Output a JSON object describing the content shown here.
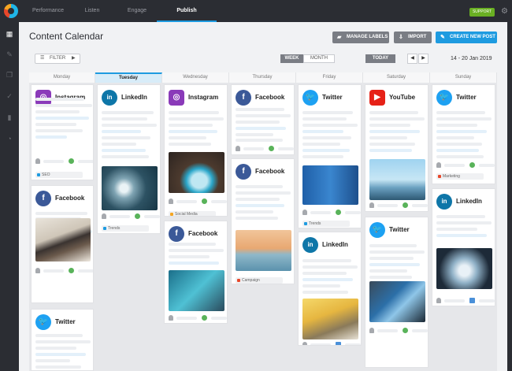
{
  "nav": {
    "tabs": [
      "Performance",
      "Listen",
      "Engage",
      "Publish"
    ],
    "support": "SUPPORT"
  },
  "header": {
    "title": "Content Calendar",
    "manage_labels": "MANAGE LABELS",
    "import": "IMPORT",
    "create_post": "CREATE NEW POST"
  },
  "controls": {
    "filter": "FILTER",
    "week": "WEEK",
    "month": "MONTH",
    "today": "TODAY",
    "prev": "◀",
    "next": "▶",
    "date_range": "14 - 20 Jan 2019"
  },
  "days": [
    "Monday",
    "Tuesday",
    "Wednesday",
    "Thursday",
    "Friday",
    "Saturday",
    "Sunday"
  ],
  "today_index": 1,
  "networks": {
    "Instagram": {
      "color": "#8a3ab9",
      "icon": "instagram-icon",
      "glyph": "◎"
    },
    "LinkedIn": {
      "color": "#0e76a8",
      "icon": "linkedin-icon",
      "glyph": "in"
    },
    "Facebook": {
      "color": "#3b5998",
      "icon": "facebook-icon",
      "glyph": "f"
    },
    "Twitter": {
      "color": "#1da1f2",
      "icon": "twitter-icon",
      "glyph": "🐦"
    },
    "YouTube": {
      "color": "#e62117",
      "icon": "youtube-icon",
      "glyph": "▶"
    }
  },
  "tags": {
    "SEO": "#1e9be0",
    "Trends": "#1e9be0",
    "Social Media": "#f5a623",
    "Campaign": "#e8472a",
    "Marketing": "#e8472a"
  },
  "cards": [
    {
      "network": "Instagram",
      "tag": "SEO"
    },
    {
      "network": "Facebook"
    },
    {
      "network": "Twitter"
    },
    {
      "network": "LinkedIn",
      "tag": "Trends"
    },
    {
      "network": "Instagram",
      "tag": "Social Media"
    },
    {
      "network": "Facebook"
    },
    {
      "network": "Facebook"
    },
    {
      "network": "Facebook",
      "tag": "Campaign"
    },
    {
      "network": "Twitter",
      "tag": "Trends"
    },
    {
      "network": "LinkedIn",
      "tag": "SEO"
    },
    {
      "network": "YouTube"
    },
    {
      "network": "Twitter"
    },
    {
      "network": "Twitter",
      "tag": "Marketing"
    },
    {
      "network": "LinkedIn"
    }
  ]
}
